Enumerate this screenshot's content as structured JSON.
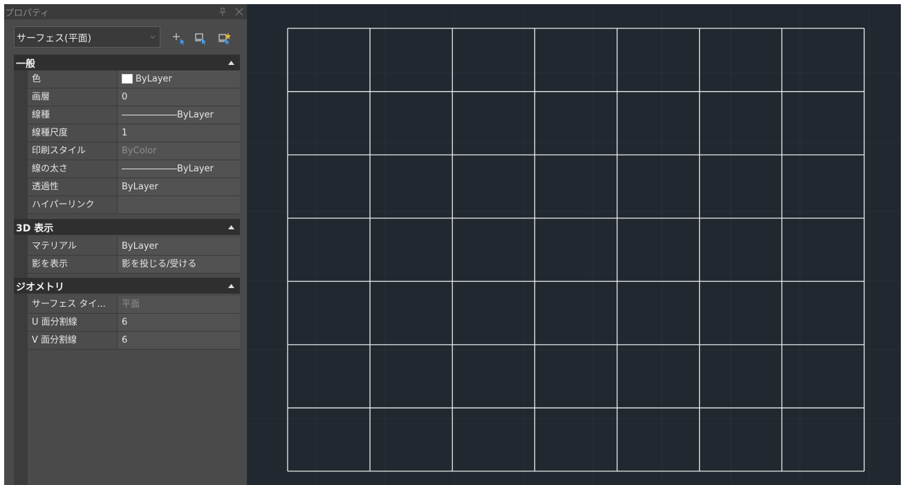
{
  "panel": {
    "title": "プロパティ",
    "object_type": "サーフェス(平面)"
  },
  "toolbar": {
    "icons": [
      "add-to-selection-icon",
      "quick-select-icon",
      "toggle-pickadd-icon"
    ]
  },
  "sections": [
    {
      "title": "一般",
      "rows": [
        {
          "name": "色",
          "value": "ByLayer",
          "swatch_color": "#ffffff"
        },
        {
          "name": "画層",
          "value": "0"
        },
        {
          "name": "線種",
          "value": "ByLayer",
          "line_sample": true
        },
        {
          "name": "線種尺度",
          "value": "1"
        },
        {
          "name": "印刷スタイル",
          "value": "ByColor",
          "disabled": true
        },
        {
          "name": "線の太さ",
          "value": "ByLayer",
          "line_sample": true
        },
        {
          "name": "透過性",
          "value": "ByLayer"
        },
        {
          "name": "ハイパーリンク",
          "value": ""
        }
      ]
    },
    {
      "title": "3D 表示",
      "rows": [
        {
          "name": "マテリアル",
          "value": "ByLayer"
        },
        {
          "name": "影を表示",
          "value": "影を投じる/受ける"
        }
      ]
    },
    {
      "title": "ジオメトリ",
      "rows": [
        {
          "name": "サーフェス タイ...",
          "value": "平面",
          "disabled": true
        },
        {
          "name": "U 面分割線",
          "value": "6"
        },
        {
          "name": "V 面分割線",
          "value": "6"
        }
      ]
    }
  ],
  "drawing": {
    "background": "#212830",
    "u_divisions": 6,
    "v_divisions": 6,
    "line_color": "#f0f0f0"
  }
}
